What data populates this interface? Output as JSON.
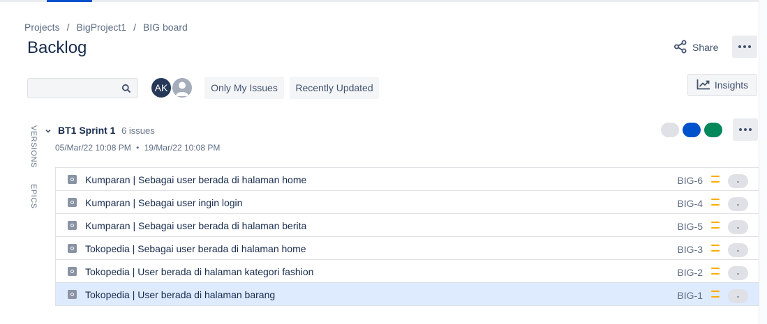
{
  "breadcrumb": {
    "items": [
      "Projects",
      "BigProject1",
      "BIG board"
    ],
    "separator": "/"
  },
  "page": {
    "title": "Backlog"
  },
  "header_actions": {
    "share_label": "Share",
    "more_icon": "more-icon"
  },
  "toolbar": {
    "search": {
      "value": "",
      "placeholder": ""
    },
    "avatars": [
      {
        "initials": "AK",
        "color": "#253858"
      },
      {
        "initials": "",
        "color": "#a5adba"
      }
    ],
    "filters": [
      "Only My Issues",
      "Recently Updated"
    ],
    "insights_label": "Insights"
  },
  "side_tabs": [
    "VERSIONS",
    "EPICS"
  ],
  "sprint": {
    "name": "BT1 Sprint 1",
    "issue_count": "6 issues",
    "start": "05/Mar/22 10:08 PM",
    "end": "19/Mar/22 10:08 PM",
    "date_separator": "•",
    "status_colors": [
      "#dfe1e6",
      "#0052cc",
      "#00875a"
    ],
    "issues": [
      {
        "summary": "Kumparan | Sebagai user berada di halaman home",
        "key": "BIG-6",
        "priority": "medium",
        "estimate": "-"
      },
      {
        "summary": "Kumparan | Sebagai user ingin login",
        "key": "BIG-4",
        "priority": "medium",
        "estimate": "-"
      },
      {
        "summary": "Kumparan | Sebagai user berada di halaman berita",
        "key": "BIG-5",
        "priority": "medium",
        "estimate": "-"
      },
      {
        "summary": "Tokopedia | Sebagai user berada di halaman home",
        "key": "BIG-3",
        "priority": "medium",
        "estimate": "-"
      },
      {
        "summary": "Tokopedia | User berada di halaman kategori fashion",
        "key": "BIG-2",
        "priority": "medium",
        "estimate": "-"
      },
      {
        "summary": "Tokopedia | User berada di halaman barang",
        "key": "BIG-1",
        "priority": "medium",
        "estimate": "-",
        "selected": true
      }
    ]
  },
  "colors": {
    "accent": "#0052cc",
    "priority_medium": "#ffab00",
    "selected_row": "#deebff"
  }
}
